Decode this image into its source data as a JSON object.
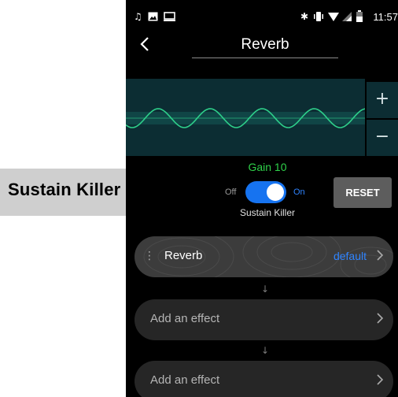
{
  "status_bar": {
    "left_icons": [
      "music-note-icon",
      "image-icon",
      "screen-icon"
    ],
    "right_icons": [
      "bluetooth-icon",
      "vibrate-icon",
      "wifi-icon",
      "signal-icon",
      "battery-icon"
    ],
    "time": "11:57"
  },
  "header": {
    "title": "Reverb",
    "back_icon": "chevron-left-icon"
  },
  "waveform": {
    "plus_label": "+",
    "minus_label": "−",
    "wave_color": "#2ecf8a"
  },
  "gain": {
    "label": "Gain 10"
  },
  "toggle": {
    "off_label": "Off",
    "on_label": "On",
    "state": "on",
    "caption": "Sustain Killer"
  },
  "reset": {
    "label": "RESET"
  },
  "effects": [
    {
      "name": "Reverb",
      "preset": "default"
    },
    {
      "placeholder": "Add an effect"
    },
    {
      "placeholder": "Add an effect"
    }
  ],
  "arrows": {
    "down": "↓"
  },
  "callout": {
    "text": "Sustain Killer"
  },
  "colors": {
    "accent": "#1673f0",
    "gain_text": "#2fd14a",
    "panel": "#0c2d33"
  }
}
